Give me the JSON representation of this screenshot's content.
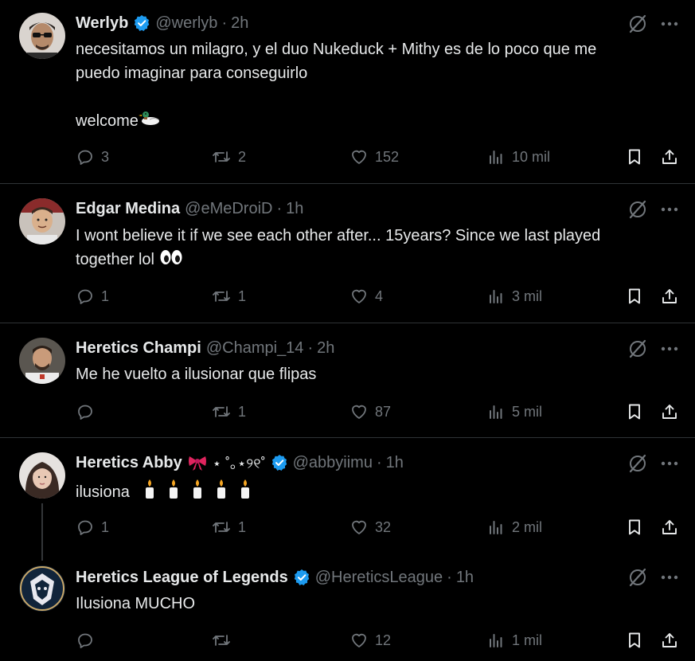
{
  "colors": {
    "background": "#000000",
    "text": "#e7e9ea",
    "muted": "#71767b",
    "separator": "#2f3336",
    "verified": "#1d9bf0"
  },
  "icons": {
    "reply": "reply-icon",
    "retweet": "retweet-icon",
    "like": "heart-icon",
    "views": "views-icon",
    "bookmark": "bookmark-icon",
    "share": "share-icon",
    "grok": "grok-icon",
    "more": "more-icon",
    "verified": "verified-badge-icon"
  },
  "tweets": [
    {
      "name": "Werlyb",
      "verified": true,
      "handle": "@werlyb",
      "time": "2h",
      "lines": [
        "necesitamos un milagro, y el duo Nukeduck + Mithy es de lo poco que me",
        "puedo imaginar para conseguirlo",
        "",
        "welcome"
      ],
      "replies": "3",
      "retweets": "2",
      "likes": "152",
      "views": "10 mil"
    },
    {
      "name": "Edgar Medina",
      "verified": false,
      "handle": "@eMeDroiD",
      "time": "1h",
      "lines": [
        "I wont believe it if we see each other after... 15years? Since we last played",
        "together lol"
      ],
      "replies": "1",
      "retweets": "1",
      "likes": "4",
      "views": "3 mil"
    },
    {
      "name": "Heretics Champi",
      "verified": false,
      "handle": "@Champi_14",
      "time": "2h",
      "lines": [
        "Me he vuelto a ilusionar que flipas"
      ],
      "replies": "",
      "retweets": "1",
      "likes": "87",
      "views": "5 mil"
    },
    {
      "name": "Heretics Abby",
      "name_decor": "⋆ ˚｡⋆୨୧˚",
      "verified": true,
      "handle": "@abbyiimu",
      "time": "1h",
      "lines": [
        "ilusiona"
      ],
      "replies": "1",
      "retweets": "1",
      "likes": "32",
      "views": "2 mil"
    },
    {
      "name": "Heretics League of Legends",
      "verified": true,
      "handle": "@HereticsLeague",
      "time": "1h",
      "lines": [
        "Ilusiona MUCHO"
      ],
      "replies": "",
      "retweets": "",
      "likes": "12",
      "views": "1 mil"
    }
  ],
  "separator_dot": "·"
}
